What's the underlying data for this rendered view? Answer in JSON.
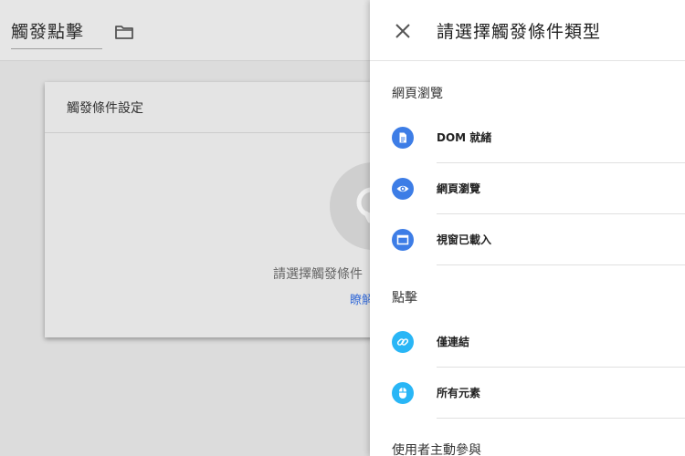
{
  "header": {
    "trigger_name": "觸發點擊",
    "folder_icon": "folder-icon"
  },
  "card": {
    "title": "觸發條件設定",
    "hint": "請選擇觸發條件",
    "link": "瞭解"
  },
  "panel": {
    "title": "請選擇觸發條件類型",
    "close_icon": "close-icon",
    "sections": [
      {
        "title": "網頁瀏覽",
        "items": [
          {
            "label": "DOM 就緒",
            "icon": "document-icon",
            "color": "#3d7de6"
          },
          {
            "label": "網頁瀏覽",
            "icon": "eye-icon",
            "color": "#3d7de6"
          },
          {
            "label": "視窗已載入",
            "icon": "window-icon",
            "color": "#3d7de6"
          }
        ]
      },
      {
        "title": "點擊",
        "items": [
          {
            "label": "僅連結",
            "icon": "link-icon",
            "color": "#29b6f6"
          },
          {
            "label": "所有元素",
            "icon": "mouse-icon",
            "color": "#29b6f6"
          }
        ]
      },
      {
        "title": "使用者主動參與",
        "items": []
      }
    ]
  }
}
